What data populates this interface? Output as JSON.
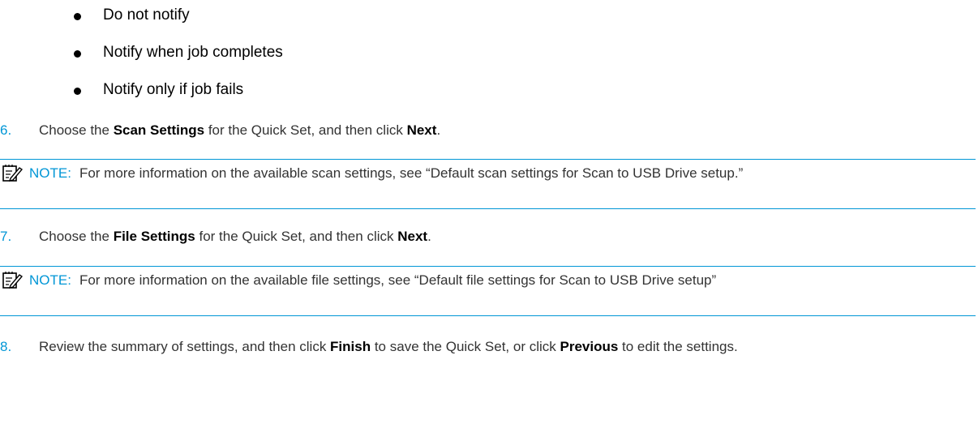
{
  "bullets": [
    {
      "text": "Do not notify"
    },
    {
      "text": "Notify when job completes"
    },
    {
      "text": "Notify only if job fails"
    }
  ],
  "steps": {
    "s6": {
      "number": "6.",
      "pre": "Choose the ",
      "bold1": "Scan Settings",
      "mid": " for the Quick Set, and then click ",
      "bold2": "Next",
      "post": "."
    },
    "s7": {
      "number": "7.",
      "pre": "Choose the ",
      "bold1": "File Settings",
      "mid": " for the Quick Set, and then click ",
      "bold2": "Next",
      "post": "."
    },
    "s8": {
      "number": "8.",
      "pre": "Review the summary of settings, and then click ",
      "bold1": "Finish",
      "mid": " to save the Quick Set, or click ",
      "bold2": "Previous",
      "post": " to edit the settings."
    }
  },
  "notes": {
    "n1": {
      "label": "NOTE:",
      "text": "For more information on the available scan settings, see “Default scan settings for Scan to USB Drive setup.”"
    },
    "n2": {
      "label": "NOTE:",
      "text": "For more information on the available file settings, see “Default file settings for Scan to USB Drive setup”"
    }
  },
  "colors": {
    "accent": "#0096d6",
    "text": "#333333"
  },
  "icons": {
    "note_icon": "note-pencil-icon"
  }
}
